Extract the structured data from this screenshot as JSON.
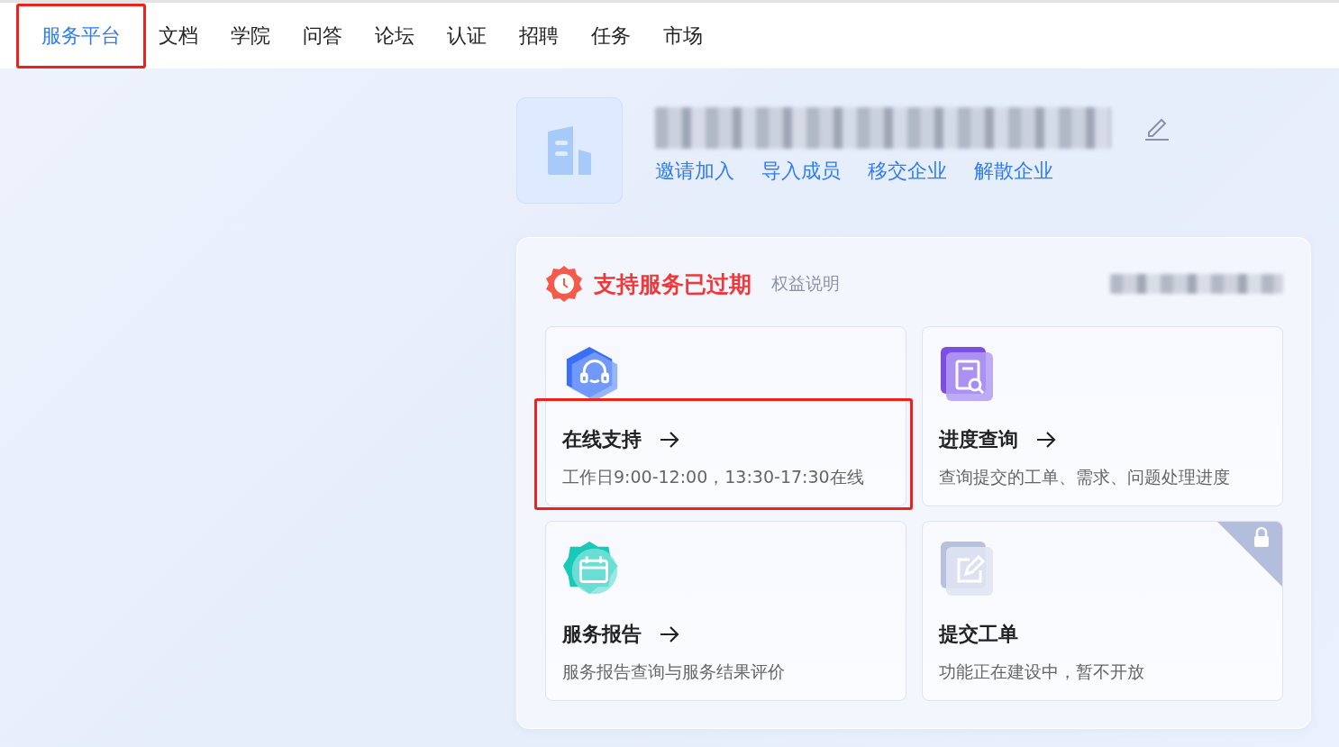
{
  "nav": {
    "items": [
      {
        "label": "服务平台",
        "selected": true,
        "highlighted": true
      },
      {
        "label": "文档",
        "selected": false,
        "highlighted": false
      },
      {
        "label": "学院",
        "selected": false,
        "highlighted": false
      },
      {
        "label": "问答",
        "selected": false,
        "highlighted": false
      },
      {
        "label": "论坛",
        "selected": false,
        "highlighted": false
      },
      {
        "label": "认证",
        "selected": false,
        "highlighted": false
      },
      {
        "label": "招聘",
        "selected": false,
        "highlighted": false
      },
      {
        "label": "任务",
        "selected": false,
        "highlighted": false
      },
      {
        "label": "市场",
        "selected": false,
        "highlighted": false
      }
    ]
  },
  "company": {
    "actions": [
      "邀请加入",
      "导入成员",
      "移交企业",
      "解散企业"
    ]
  },
  "support": {
    "status": "支持服务已过期",
    "link": "权益说明",
    "cards": [
      {
        "kind": "headset",
        "title": "在线支持",
        "description": "工作日9:00-12:00，13:30-17:30在线",
        "arrow": true,
        "locked": false,
        "highlighted": true
      },
      {
        "kind": "search",
        "title": "进度查询",
        "description": "查询提交的工单、需求、问题处理进度",
        "arrow": true,
        "locked": false,
        "highlighted": false
      },
      {
        "kind": "calendar",
        "title": "服务报告",
        "description": "服务报告查询与服务结果评价",
        "arrow": true,
        "locked": false,
        "highlighted": false
      },
      {
        "kind": "edit",
        "title": "提交工单",
        "description": "功能正在建设中，暂不开放",
        "arrow": false,
        "locked": true,
        "highlighted": false
      }
    ]
  }
}
